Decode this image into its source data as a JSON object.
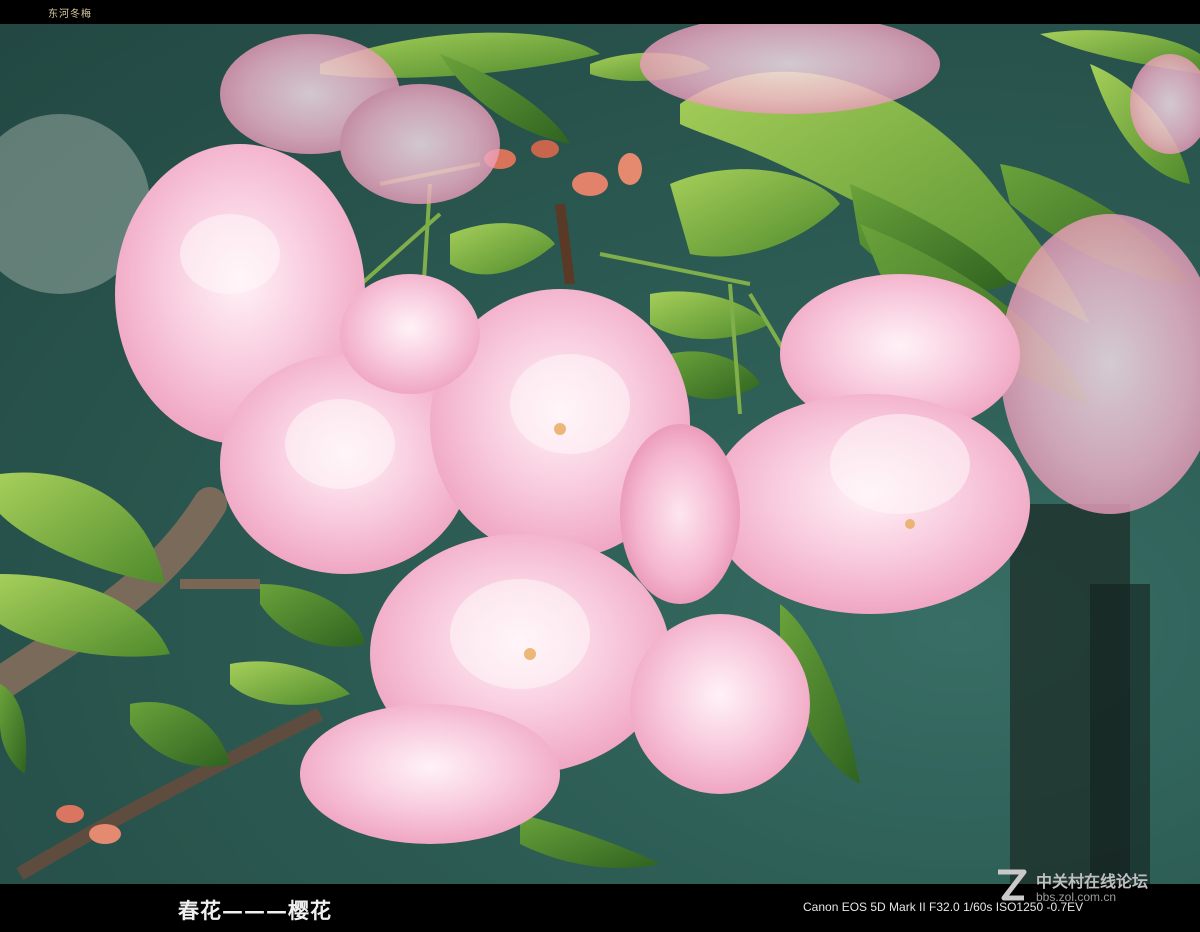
{
  "header": {
    "title": "东河冬梅"
  },
  "photo": {
    "subject": "pink double cherry blossoms",
    "colors": {
      "blossom": "#f6bcd2",
      "leaf": "#6aa23b",
      "background": "#2f6157"
    }
  },
  "footer": {
    "caption": "春花———樱花",
    "exif": "Canon EOS 5D Mark II F32.0 1/60s ISO1250 -0.7EV"
  },
  "watermark": {
    "site_name": "中关村在线论坛",
    "url": "bbs.zol.com.cn"
  }
}
